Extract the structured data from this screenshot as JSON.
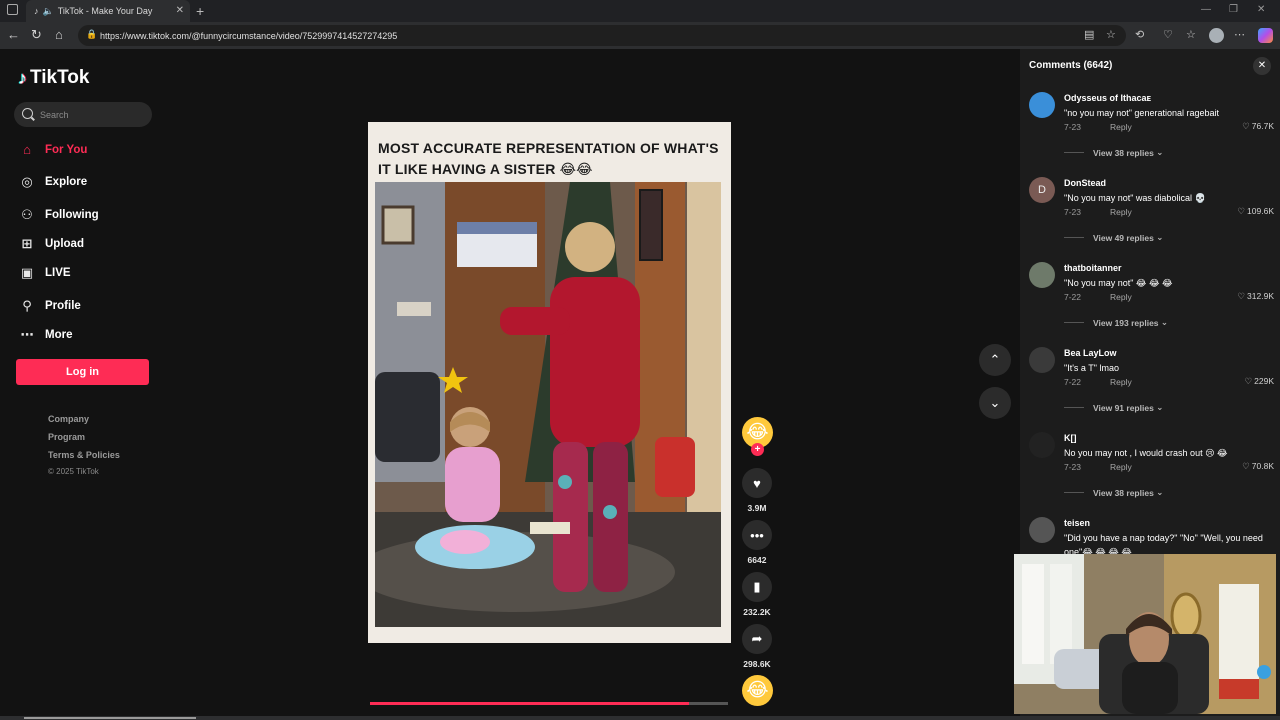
{
  "browser": {
    "tab_title": "TikTok - Make Your Day",
    "url": "https://www.tiktok.com/@funnycircumstance/video/7529997414527274295"
  },
  "sidebar": {
    "logo": "TikTok",
    "search_placeholder": "Search",
    "nav": [
      {
        "label": "For You",
        "icon": "home-icon",
        "active": true
      },
      {
        "label": "Explore",
        "icon": "compass-icon"
      },
      {
        "label": "Following",
        "icon": "following-icon"
      },
      {
        "label": "Upload",
        "icon": "upload-icon"
      },
      {
        "label": "LIVE",
        "icon": "live-icon"
      },
      {
        "label": "Profile",
        "icon": "profile-icon"
      },
      {
        "label": "More",
        "icon": "more-icon"
      }
    ],
    "login_label": "Log in",
    "footer": [
      "Company",
      "Program",
      "Terms & Policies"
    ],
    "copyright": "© 2025 TikTok"
  },
  "video": {
    "caption": "MOST ACCURATE REPRESENTATION OF WHAT'S IT LIKE HAVING A SISTER 😂😂",
    "progress": 0.89
  },
  "actions": {
    "likes": "3.9M",
    "comments": "6642",
    "saves": "232.2K",
    "shares": "298.6K"
  },
  "comments_panel": {
    "title": "Comments (6642)",
    "items": [
      {
        "user": "Odysseus of Ithacaᴇ",
        "text": "\"no you may not\" generational ragebait",
        "date": "7-23",
        "reply": "Reply",
        "likes": "76.7K",
        "view": "View 38 replies",
        "avatar_color": "#3a8fd9",
        "avatar_letter": ""
      },
      {
        "user": "DonStead",
        "text": "\"No you may not\" was diabolical 💀",
        "date": "7-23",
        "reply": "Reply",
        "likes": "109.6K",
        "view": "View 49 replies",
        "avatar_color": "#7a5a54",
        "avatar_letter": "D"
      },
      {
        "user": "thatboitanner",
        "text": "\"No you may not\" 😂 😂 😂",
        "date": "7-22",
        "reply": "Reply",
        "likes": "312.9K",
        "view": "View 193 replies",
        "avatar_color": "#6e7a6a",
        "avatar_letter": ""
      },
      {
        "user": "Bea LayLow",
        "text": "\"It's a T\" lmao",
        "date": "7-22",
        "reply": "Reply",
        "likes": "229K",
        "view": "View 91 replies",
        "avatar_color": "#3a3a3a",
        "avatar_letter": ""
      },
      {
        "user": "K[]",
        "text": "No you may not , I would crash out 😢 😂",
        "date": "7-23",
        "reply": "Reply",
        "likes": "70.8K",
        "view": "View 38 replies",
        "avatar_color": "#222222",
        "avatar_letter": ""
      },
      {
        "user": "teisen",
        "text": "\"Did you have a nap today?\" \"No\" \"Well, you need one\"😂 😂 😂 😂",
        "date": "",
        "reply": "",
        "likes": "",
        "view": "",
        "avatar_color": "#555555",
        "avatar_letter": ""
      }
    ]
  }
}
